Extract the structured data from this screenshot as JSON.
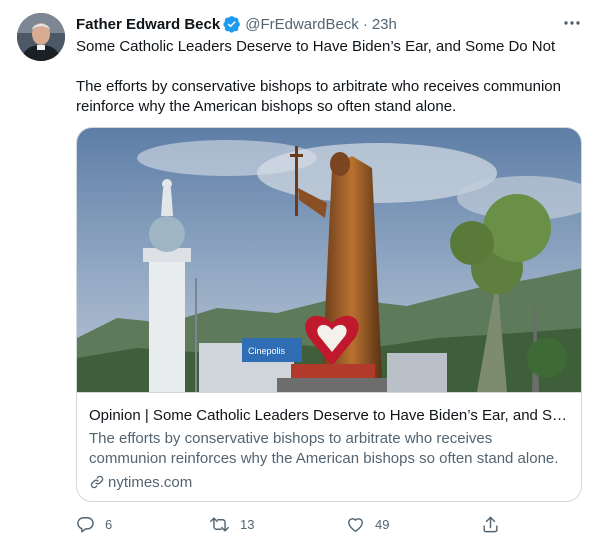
{
  "author": {
    "name": "Father Edward Beck",
    "handle": "@FrEdwardBeck",
    "separator": "·",
    "time": "23h",
    "verified": true,
    "avatar_icon": "profile-avatar"
  },
  "tweet": {
    "line1": "Some Catholic Leaders Deserve to Have Biden’s Ear, and Some Do Not",
    "line2": "The efforts by conservative bishops to arbitrate who receives communion reinforce why the American bishops so often stand alone."
  },
  "card": {
    "title": "Opinion | Some Catholic Leaders Deserve to Have Biden’s Ear, and So…",
    "description": "The efforts by conservative bishops to arbitrate who receives communion reinforces why the American bishops so often stand alone.",
    "domain": "nytimes.com",
    "image_sign_text": "Cinepolis",
    "image_description_icon": "statue-photo"
  },
  "actions": {
    "reply_count": "6",
    "retweet_count": "13",
    "like_count": "49"
  },
  "colors": {
    "text_primary": "#0f1419",
    "text_secondary": "#536471",
    "verified_blue": "#1d9bf0",
    "border": "#cfd9de"
  }
}
